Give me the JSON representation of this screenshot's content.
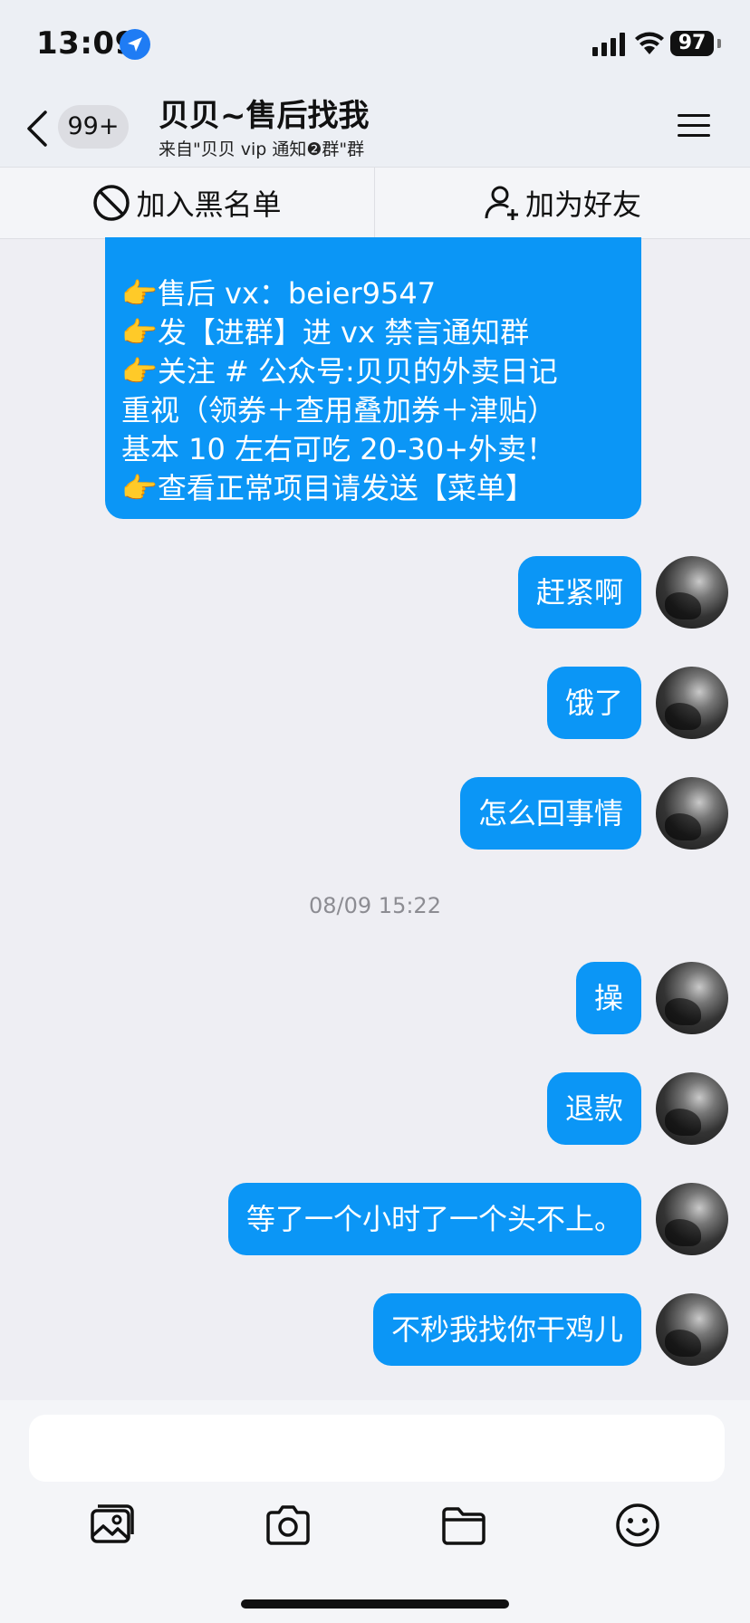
{
  "status_bar": {
    "time": "13:09",
    "battery": "97"
  },
  "header": {
    "unread_badge": "99+",
    "title": "贝贝~售后找我",
    "subtitle": "来自\"贝贝 vip 通知❷群\"群"
  },
  "actions": {
    "blacklist": "加入黑名单",
    "add_friend": "加为好友"
  },
  "pinned_message": {
    "lines": [
      "👉售后 vx：beier9547",
      "👉发【进群】进 vx 禁言通知群",
      "👉关注 # 公众号:贝贝的外卖日记",
      "   重视（领券＋查用叠加券＋津贴）",
      "   基本 10 左右可吃 20-30+外卖！",
      "👉查看正常项目请发送【菜单】"
    ]
  },
  "messages_before": [
    "赶紧啊",
    "饿了",
    "怎么回事情"
  ],
  "timestamp": "08/09 15:22",
  "messages_after": [
    "操",
    "退款",
    "等了一个小时了一个头不上。",
    "不秒我找你干鸡儿"
  ],
  "input": {
    "placeholder": ""
  },
  "toolbar_icons": [
    "image-icon",
    "camera-icon",
    "folder-icon",
    "emoji-icon"
  ],
  "colors": {
    "bubble": "#0b96f6",
    "background": "#eeeef3",
    "accent": "#1f7cf4"
  }
}
